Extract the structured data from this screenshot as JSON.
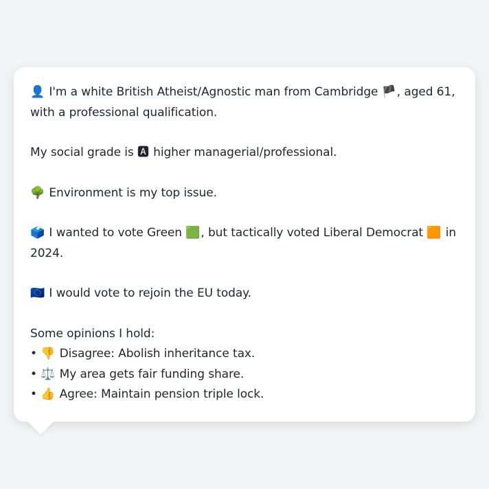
{
  "profile": {
    "intro_icon": "👤",
    "intro_text_1": "I'm a white British Atheist/Agnostic man from Cambridge",
    "intro_flag": "🏴",
    "intro_text_2": ", aged 61, with a professional qualification.",
    "grade_text_1": "My social grade is",
    "grade_icon": "🅰",
    "grade_text_2": "higher managerial/professional.",
    "issue_icon": "🌳",
    "issue_text": "Environment is my top issue.",
    "vote_icon": "🗳️",
    "vote_text_1": "I wanted to vote Green",
    "vote_green_icon": "🟩",
    "vote_text_2": ", but tactically voted Liberal Democrat",
    "vote_orange_icon": "🟧",
    "vote_text_3": "in 2024.",
    "eu_icon": "🇪🇺",
    "eu_text": "I would vote to rejoin the EU today.",
    "opinions_heading": "Some opinions I hold:",
    "opinions": [
      {
        "bullet": "•",
        "icon": "👎",
        "text": "Disagree: Abolish inheritance tax."
      },
      {
        "bullet": "•",
        "icon": "⚖️",
        "text": "My area gets fair funding share."
      },
      {
        "bullet": "•",
        "icon": "👍",
        "text": "Agree: Maintain pension triple lock."
      }
    ]
  },
  "colors": {
    "background": "#f2f3f5",
    "bubble": "#ffffff",
    "text": "#1f2430"
  }
}
